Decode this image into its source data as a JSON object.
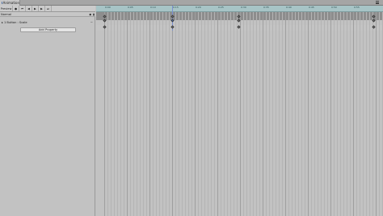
{
  "window": {
    "tab_title": "Animation"
  },
  "toolbar": {
    "preview_label": "Preview",
    "controls": [
      "record-icon",
      "first-key-icon",
      "prev-key-icon",
      "play-icon",
      "next-key-icon",
      "last-key-icon"
    ]
  },
  "clip": {
    "name": "Normal"
  },
  "properties": [
    {
      "label": "▸ 1 Button : Scale"
    }
  ],
  "add_property_label": "Add Property",
  "timeline": {
    "ruler_labels": [
      "0:00",
      "0:05",
      "0:10",
      "0:15",
      "0:20",
      "0:25",
      "0:30",
      "0:35",
      "0:40",
      "0:45",
      "0:50",
      "0:55"
    ]
  }
}
